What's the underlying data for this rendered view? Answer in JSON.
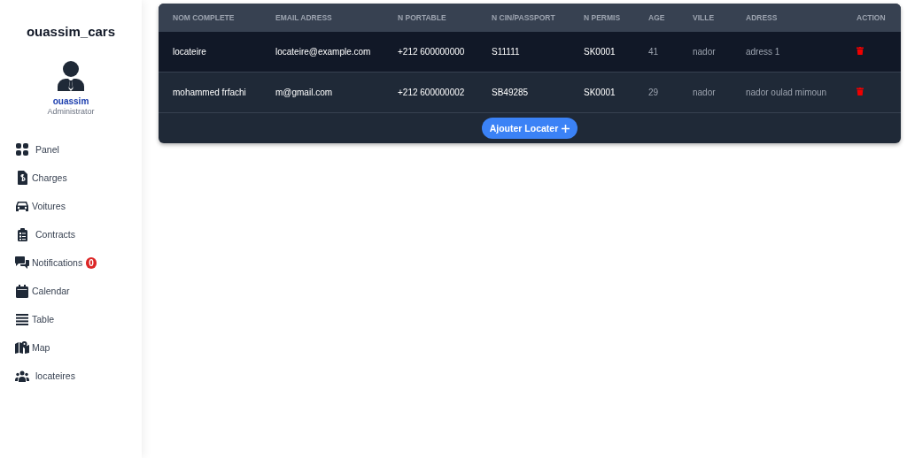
{
  "sidebar": {
    "brand": "ouassim_cars",
    "user": {
      "name": "ouassim",
      "role": "Administrator"
    },
    "items": [
      {
        "label": "Panel"
      },
      {
        "label": "Charges"
      },
      {
        "label": "Voitures"
      },
      {
        "label": "Contracts"
      },
      {
        "label": "Notifications",
        "badge": "0"
      },
      {
        "label": "Calendar"
      },
      {
        "label": "Table"
      },
      {
        "label": "Map"
      },
      {
        "label": "locateires"
      }
    ]
  },
  "table": {
    "columns": [
      "NOM COMPLETE",
      "EMAIL ADRESS",
      "N PORTABLE",
      "N CIN/PASSPORT",
      "N PERMIS",
      "AGE",
      "VILLE",
      "ADRESS",
      "ACTION"
    ],
    "rows": [
      {
        "selected": true,
        "cells": [
          "locateire",
          "locateire@example.com",
          "+212 600000000",
          "S11111",
          "SK0001",
          "41",
          "nador",
          "adress 1"
        ]
      },
      {
        "selected": false,
        "cells": [
          "mohammed frfachi",
          "m@gmail.com",
          "+212 600000002",
          "SB49285",
          "SK0001",
          "29",
          "nador",
          "nador oulad mimoun"
        ]
      }
    ],
    "add_button": "Ajouter Locater"
  }
}
